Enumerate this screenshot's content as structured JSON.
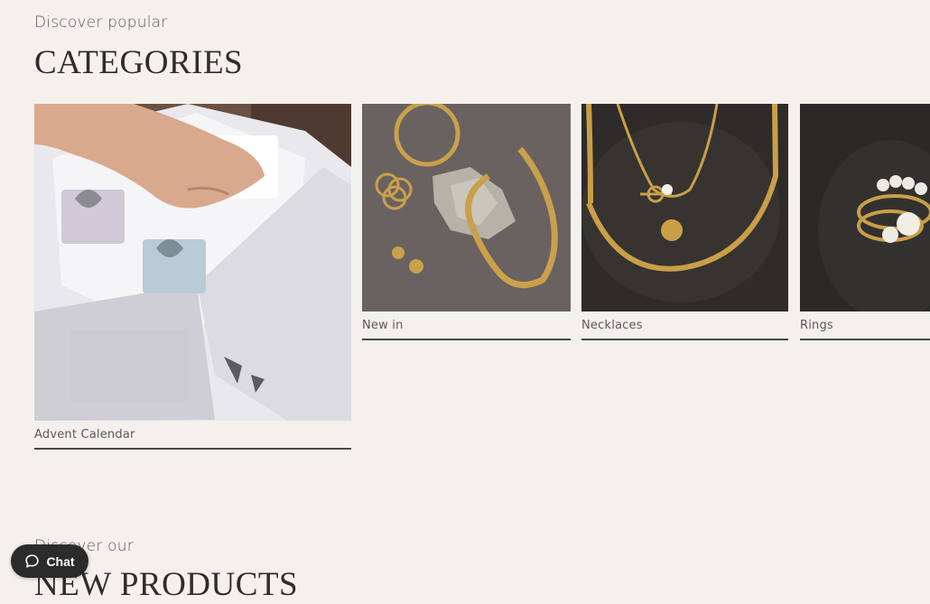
{
  "categories_section": {
    "eyebrow": "Discover popular",
    "title": "CATEGORIES",
    "cards": [
      {
        "label": "Advent Calendar"
      },
      {
        "label": "New in"
      },
      {
        "label": "Necklaces"
      },
      {
        "label": "Rings"
      }
    ]
  },
  "new_products_section": {
    "eyebrow": "Discover our",
    "title": "NEW PRODUCTS"
  },
  "chat": {
    "label": "Chat",
    "icon": "chat-bubble-icon"
  },
  "colors": {
    "background": "#f4f1ec",
    "text": "#3a3733",
    "chat_button": "#2b2b2b"
  }
}
